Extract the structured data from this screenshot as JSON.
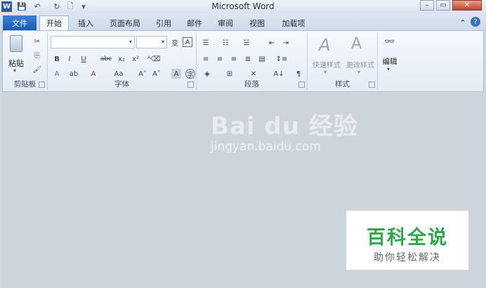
{
  "window": {
    "title": "Microsoft Word",
    "app_icon": "W"
  },
  "quick_access": {
    "save": "💾",
    "undo": "↶",
    "redo": "↻",
    "new": "🗋",
    "customize": "▾"
  },
  "window_controls": {
    "minimize": "–",
    "restore": "▭",
    "close": "✕"
  },
  "ribbon_tabs": [
    "文件",
    "开始",
    "插入",
    "页面布局",
    "引用",
    "邮件",
    "审阅",
    "视图",
    "加载项"
  ],
  "ribbon_right": {
    "minimize": "⌃",
    "help": "?"
  },
  "groups": {
    "clipboard": {
      "label": "剪贴板",
      "paste": "粘贴"
    },
    "font": {
      "label": "字体",
      "font_name": "",
      "font_size": ""
    },
    "paragraph": {
      "label": "段落"
    },
    "styles": {
      "label": "样式",
      "quick_styles": "快速样式",
      "change_styles": "更改样式"
    },
    "editing": {
      "label": "编辑"
    }
  },
  "watermark": {
    "brand": "Bai du 经验",
    "url": "jingyan.baidu.com"
  },
  "badge": {
    "title": "百科全说",
    "subtitle": "助你轻松解决"
  },
  "colors": {
    "accent": "#2b6fc9",
    "badge_green": "#2ea84a",
    "doc_bg": "#cdd4dc"
  }
}
